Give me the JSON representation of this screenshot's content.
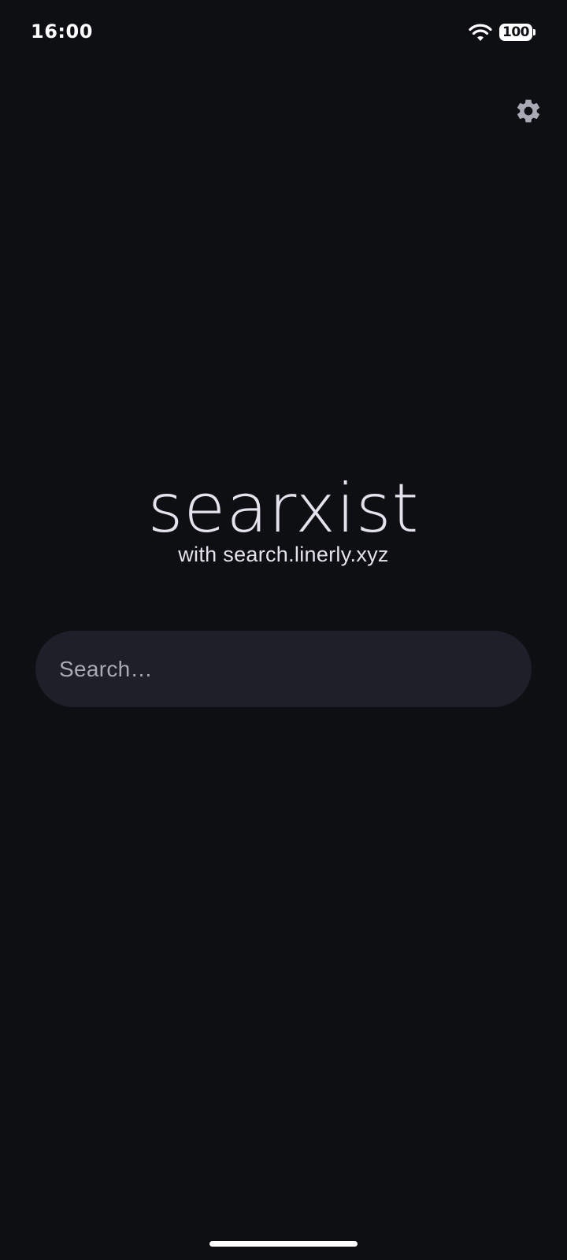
{
  "status_bar": {
    "time": "16:00",
    "battery_level": "100",
    "wifi_icon": "wifi-icon",
    "battery_icon": "battery-icon"
  },
  "header": {
    "settings_icon": "gear-icon"
  },
  "brand": {
    "title": "searxist",
    "subtitle": "with search.linerly.xyz"
  },
  "search": {
    "placeholder": "Search…",
    "value": ""
  },
  "colors": {
    "background": "#0e0f13",
    "search_field": "#1d2029",
    "text_primary": "#e4e2ec",
    "placeholder": "#a7a9b3",
    "icon": "#a7a9b3"
  }
}
